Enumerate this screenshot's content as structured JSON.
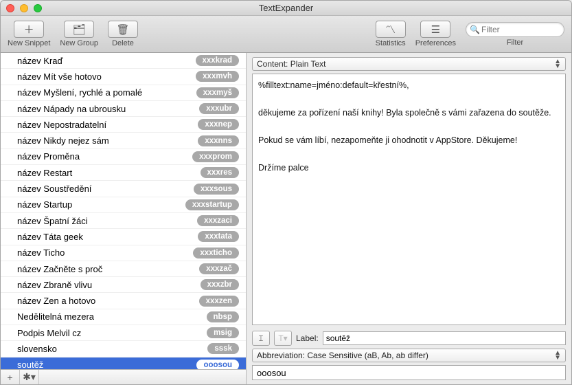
{
  "window": {
    "title": "TextExpander"
  },
  "toolbar": {
    "new_snippet": "New Snippet",
    "new_group": "New Group",
    "delete": "Delete",
    "statistics": "Statistics",
    "preferences": "Preferences",
    "filter_label": "Filter",
    "filter_placeholder": "Filter"
  },
  "snippets": [
    {
      "name": "název Kraď",
      "abbr": "xxxkrad"
    },
    {
      "name": "název Mít vše hotovo",
      "abbr": "xxxmvh"
    },
    {
      "name": "název Myšlení, rychlé a pomalé",
      "abbr": "xxxmyš"
    },
    {
      "name": "název Nápady na ubrousku",
      "abbr": "xxxubr"
    },
    {
      "name": "název Nepostradatelní",
      "abbr": "xxxnep"
    },
    {
      "name": "název Nikdy nejez sám",
      "abbr": "xxxnns"
    },
    {
      "name": "název Proměna",
      "abbr": "xxxprom"
    },
    {
      "name": "název Restart",
      "abbr": "xxxres"
    },
    {
      "name": "název Soustředění",
      "abbr": "xxxsous"
    },
    {
      "name": "název Startup",
      "abbr": "xxxstartup"
    },
    {
      "name": "název Špatní žáci",
      "abbr": "xxxzaci"
    },
    {
      "name": "název Táta geek",
      "abbr": "xxxtata"
    },
    {
      "name": "název Ticho",
      "abbr": "xxxticho"
    },
    {
      "name": "název Začněte s proč",
      "abbr": "xxxzač"
    },
    {
      "name": "název Zbraně vlivu",
      "abbr": "xxxzbr"
    },
    {
      "name": "název Zen a hotovo",
      "abbr": "xxxzen"
    },
    {
      "name": "Nedělitelná mezera",
      "abbr": "nbsp"
    },
    {
      "name": "Podpis Melvil cz",
      "abbr": "msig"
    },
    {
      "name": "slovensko",
      "abbr": "sssk"
    },
    {
      "name": "soutěž",
      "abbr": "ooosou",
      "selected": true
    }
  ],
  "detail": {
    "content_type_label": "Content: Plain Text",
    "body": "%filltext:name=jméno:default=křestní%,\n\nděkujeme za pořízení naší knihy! Byla společně s vámi zařazena do soutěže.\n\nPokud se vám líbí, nezapomeňte ji ohodnotit v AppStore. Děkujeme!\n\nDržíme palce",
    "label_caption": "Label:",
    "label_value": "soutěž",
    "abbrev_mode": "Abbreviation: Case Sensitive (aB, Ab, ab differ)",
    "abbrev_value": "ooosou"
  },
  "footer": {
    "add": "+",
    "gear": "✱"
  },
  "icons": {
    "plus": "＋",
    "folder": "🗂",
    "trash": "🗑",
    "stats": "〽",
    "prefs": "☰",
    "search": "🔍",
    "cursor": "⌶",
    "tmenu": "T▾",
    "gear": "✱▾"
  }
}
